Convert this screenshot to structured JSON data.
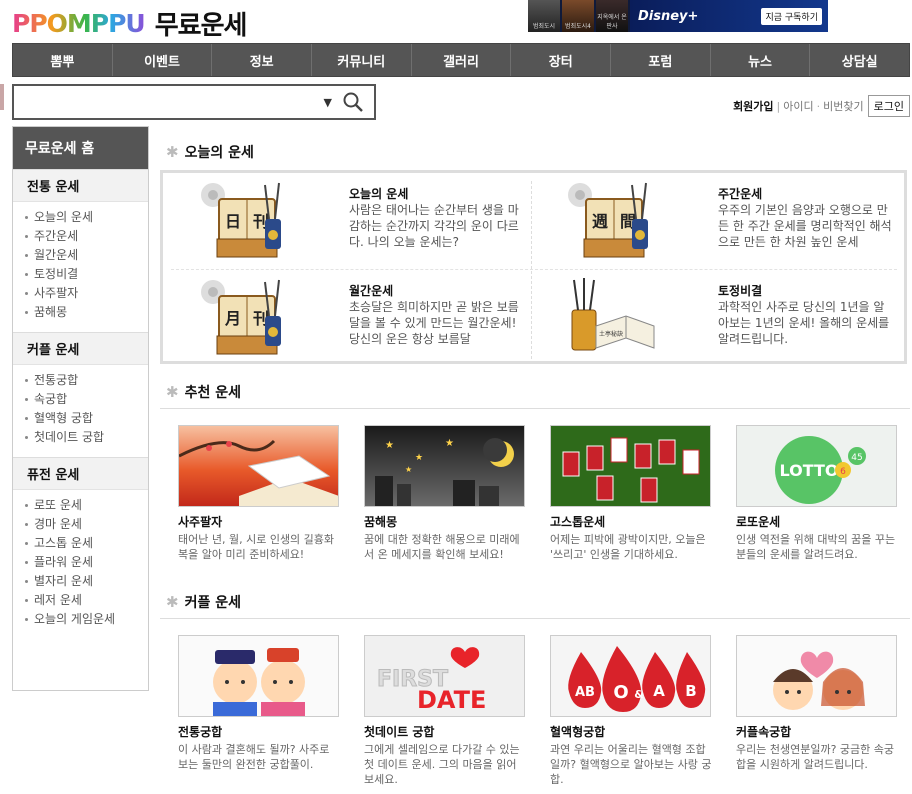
{
  "header": {
    "logo": "PPOMPPU",
    "title": "무료운세",
    "banner": {
      "thumbs": [
        "범죄도시",
        "범죄도시4",
        "지옥에서 온 판사"
      ],
      "brand": "Disney+",
      "cta": "지금 구독하기"
    }
  },
  "nav": [
    "뽐뿌",
    "이벤트",
    "정보",
    "커뮤니티",
    "갤러리",
    "장터",
    "포럼",
    "뉴스",
    "상담실"
  ],
  "search": {
    "placeholder": ""
  },
  "util": {
    "join": "회원가입",
    "id": "아이디",
    "pw": "비번찾기",
    "login": "로그인"
  },
  "sidebar": {
    "home": "무료운세 홈",
    "sections": [
      {
        "title": "전통 운세",
        "items": [
          "오늘의 운세",
          "주간운세",
          "월간운세",
          "토정비결",
          "사주팔자",
          "꿈해몽"
        ]
      },
      {
        "title": "커플 운세",
        "items": [
          "전통궁합",
          "속궁합",
          "혈액형 궁합",
          "첫데이트 궁합"
        ]
      },
      {
        "title": "퓨전 운세",
        "items": [
          "로또 운세",
          "경마 운세",
          "고스톱 운세",
          "플라워 운세",
          "별자리 운세",
          "레저 운세",
          "오늘의 게임운세"
        ]
      }
    ]
  },
  "today": {
    "title": "오늘의 운세",
    "items": [
      {
        "title": "오늘의 운세",
        "desc": "사람은 태어나는 순간부터 생을 마감하는 순간까지 각각의 운이 다르다. 나의 오늘 운세는?",
        "glyphs": [
          "日",
          "刊"
        ]
      },
      {
        "title": "주간운세",
        "desc": "우주의 기본인 음양과 오행으로 만든 한 주간 운세를 명리학적인 해석으로 만든 한 차원 높인 운세",
        "glyphs": [
          "週",
          "間"
        ]
      },
      {
        "title": "월간운세",
        "desc": "초승달은 희미하지만 곧 밝은 보름달을 볼 수 있게 만드는 월간운세! 당신의 운은 항상 보름달",
        "glyphs": [
          "月",
          "刊"
        ]
      },
      {
        "title": "토정비결",
        "desc": "과학적인 사주로 당신의 1년을 알아보는 1년의 운세! 올해의 운세를 알려드립니다.",
        "glyphs": [
          "土亭秘訣"
        ]
      }
    ]
  },
  "recommend": {
    "title": "추천 운세",
    "cards": [
      {
        "title": "사주팔자",
        "desc": "태어난 년, 월, 시로 인생의 길흉화복을 알아 미리 준비하세요!"
      },
      {
        "title": "꿈해몽",
        "desc": "꿈에 대한 정확한 해몽으로 미래에서 온 메세지를 확인해 보세요!"
      },
      {
        "title": "고스톱운세",
        "desc": "어제는 피박에 광박이지만, 오늘은 '쓰리고' 인생을 기대하세요."
      },
      {
        "title": "로또운세",
        "desc": "인생 역전을 위해 대박의 꿈을 꾸는 분들의 운세를 알려드려요.",
        "img_text": "LOTTO",
        "img_num": "45",
        "img_num2": "6"
      }
    ]
  },
  "couple": {
    "title": "커플 운세",
    "cards": [
      {
        "title": "전통궁합",
        "desc": "이 사람과 결혼해도 될까? 사주로 보는 둘만의 완전한 궁합풀이."
      },
      {
        "title": "첫데이트 궁합",
        "desc": "그에게 셀레임으로 다가갈 수 있는 첫 데이트 운세. 그의 마음을 읽어보세요.",
        "img_text1": "FIRST",
        "img_text2": "DATE"
      },
      {
        "title": "혈액형궁합",
        "desc": "과연 우리는 어울리는 혈액형 조합일까? 혈액형으로 알아보는 사랑 궁합.",
        "img_labels": [
          "AB",
          "O",
          "&",
          "A",
          "B"
        ]
      },
      {
        "title": "커플속궁합",
        "desc": "우리는 천생연분일까? 궁금한 속궁합을 시원하게 알려드립니다."
      }
    ]
  }
}
